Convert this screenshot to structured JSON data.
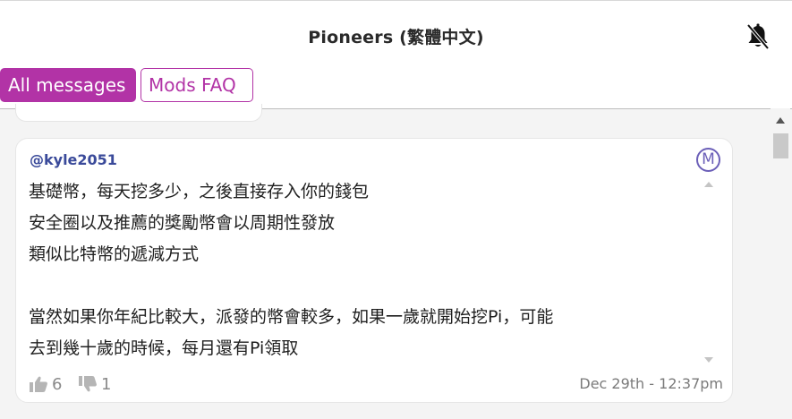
{
  "header": {
    "title": "Pioneers (繁體中文)",
    "icon": "bell-muted-icon"
  },
  "tabs": [
    {
      "label": "All messages",
      "active": true
    },
    {
      "label": "Mods FAQ",
      "active": false
    }
  ],
  "colors": {
    "accent": "#b233a6",
    "author": "#3a4a9a",
    "mod_badge": "#6b5fb8",
    "background": "#f4f4f4"
  },
  "message": {
    "author": "@kyle2051",
    "badge": "M",
    "lines": [
      "基礎幣，每天挖多少，之後直接存入你的錢包",
      "安全圈以及推薦的獎勵幣會以周期性發放",
      "類似比特幣的遞減方式",
      "",
      "當然如果你年紀比較大，派發的幣會較多，如果一歲就開始挖Pi，可能",
      "去到幾十歲的時候，每月還有Pi領取"
    ],
    "upvotes": "6",
    "downvotes": "1",
    "timestamp": "Dec 29th - 12:37pm"
  }
}
